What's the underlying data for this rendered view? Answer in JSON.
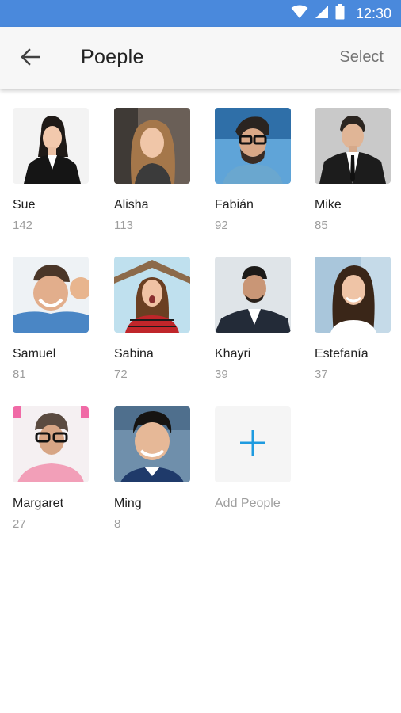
{
  "status_bar": {
    "time": "12:30",
    "icons": [
      "wifi-icon",
      "signal-icon",
      "battery-icon"
    ]
  },
  "app_bar": {
    "back_icon": "arrow-left-icon",
    "title": "Poeple",
    "select_label": "Select"
  },
  "people": [
    {
      "name": "Sue",
      "count": "142"
    },
    {
      "name": "Alisha",
      "count": "113"
    },
    {
      "name": "Fabián",
      "count": "92"
    },
    {
      "name": "Mike",
      "count": "85"
    },
    {
      "name": "Samuel",
      "count": "81"
    },
    {
      "name": "Sabina",
      "count": "72"
    },
    {
      "name": "Khayri",
      "count": "39"
    },
    {
      "name": "Estefanía",
      "count": "37"
    },
    {
      "name": "Margaret",
      "count": "27"
    },
    {
      "name": "Ming",
      "count": "8"
    }
  ],
  "add_people": {
    "label": "Add People",
    "icon": "plus-icon"
  },
  "colors": {
    "status_bar": "#4a89dc",
    "accent": "#1e9be0",
    "secondary_text": "#9e9e9e"
  }
}
